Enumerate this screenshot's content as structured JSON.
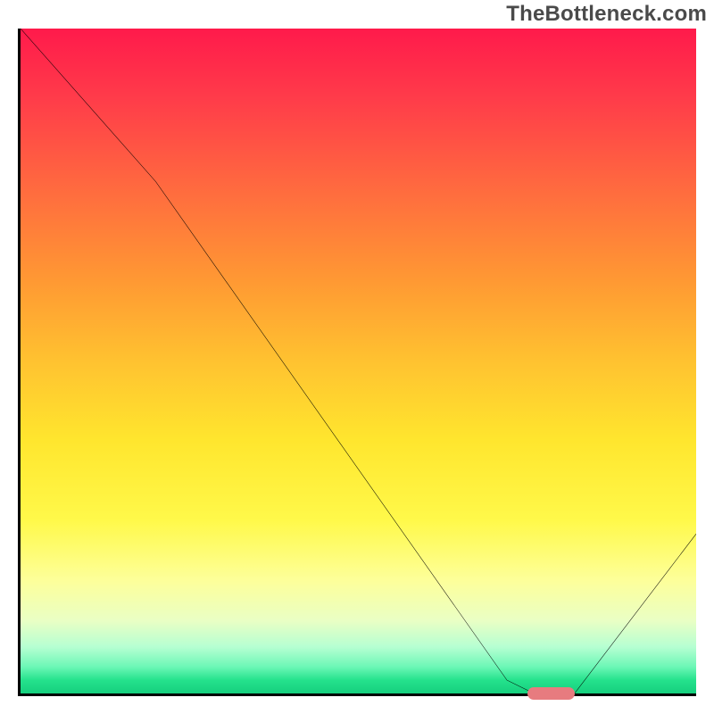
{
  "watermark": "TheBottleneck.com",
  "chart_data": {
    "type": "line",
    "title": "",
    "xlabel": "",
    "ylabel": "",
    "xlim": [
      0,
      100
    ],
    "ylim": [
      0,
      100
    ],
    "x": [
      0,
      20,
      72,
      76,
      82,
      100
    ],
    "values": [
      100,
      77,
      2,
      0,
      0,
      24
    ],
    "marker": {
      "x_start": 75,
      "x_end": 82,
      "y": 0
    },
    "gradient_stops": [
      {
        "pos": 0,
        "color": "#ff1a4b"
      },
      {
        "pos": 10,
        "color": "#ff3a4a"
      },
      {
        "pos": 24,
        "color": "#ff6a3f"
      },
      {
        "pos": 38,
        "color": "#ff9933"
      },
      {
        "pos": 50,
        "color": "#ffc230"
      },
      {
        "pos": 62,
        "color": "#ffe62e"
      },
      {
        "pos": 74,
        "color": "#fff94a"
      },
      {
        "pos": 83,
        "color": "#fdff9a"
      },
      {
        "pos": 89,
        "color": "#eaffc4"
      },
      {
        "pos": 93,
        "color": "#b6ffd2"
      },
      {
        "pos": 96,
        "color": "#6cf7b6"
      },
      {
        "pos": 98,
        "color": "#25e28c"
      },
      {
        "pos": 100,
        "color": "#15cf7e"
      }
    ],
    "marker_color": "#e77b7f"
  }
}
